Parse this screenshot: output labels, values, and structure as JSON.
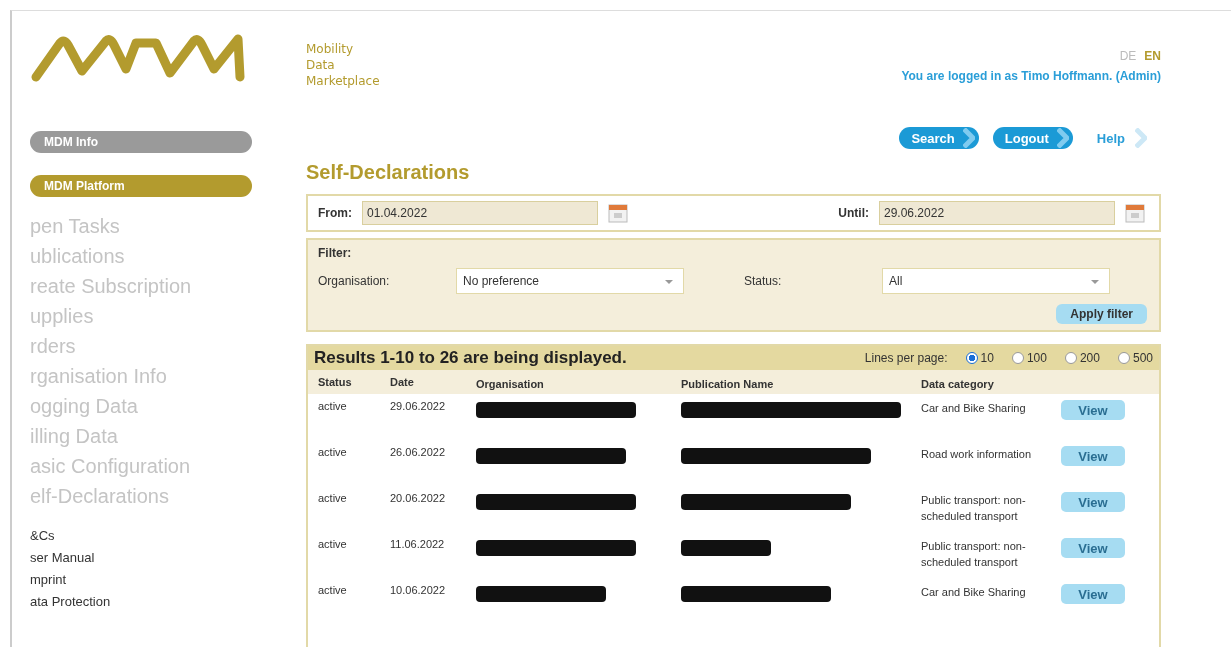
{
  "header": {
    "tagline": [
      "Mobility",
      "Data",
      "Marketplace"
    ],
    "languages": [
      {
        "label": "DE",
        "selected": false
      },
      {
        "label": "EN",
        "selected": true
      }
    ],
    "login_text": "You are logged in as Timo Hoffmann. (Admin)",
    "buttons": [
      {
        "label": "Search",
        "kind": "pill"
      },
      {
        "label": "Logout",
        "kind": "pill"
      },
      {
        "label": "Help",
        "kind": "link"
      }
    ]
  },
  "sidebar": {
    "sections": [
      {
        "label": "MDM Info",
        "selected": false
      },
      {
        "label": "MDM Platform",
        "selected": true
      }
    ],
    "items": [
      "pen Tasks",
      "ublications",
      "reate Subscription",
      "upplies",
      "rders",
      "rganisation Info",
      "ogging Data",
      "illing Data",
      "asic Configuration",
      "elf-Declarations"
    ],
    "footer_links": [
      "&Cs",
      "ser Manual",
      "mprint",
      "ata Protection"
    ]
  },
  "page_title": "Self-Declarations",
  "date_range": {
    "from_label": "From:",
    "from_value": "01.04.2022",
    "until_label": "Until:",
    "until_value": "29.06.2022"
  },
  "filter": {
    "title": "Filter:",
    "organisation_label": "Organisation:",
    "organisation_value": "No preference",
    "status_label": "Status:",
    "status_value": "All",
    "apply_button": "Apply filter"
  },
  "results": {
    "summary": "Results 1-10 to 26 are being displayed.",
    "lines_label": "Lines per page:",
    "lines_options": [
      {
        "label": "10",
        "selected": true
      },
      {
        "label": "100",
        "selected": false
      },
      {
        "label": "200",
        "selected": false
      },
      {
        "label": "500",
        "selected": false
      }
    ],
    "columns": [
      "Status",
      "Date",
      "Organisation",
      "Publication Name",
      "Data category"
    ],
    "rows": [
      {
        "status": "active",
        "date": "29.06.2022",
        "redacted": true,
        "category": "Car and Bike Sharing",
        "action": "View"
      },
      {
        "status": "active",
        "date": "26.06.2022",
        "redacted": true,
        "category": "Road work information",
        "action": "View"
      },
      {
        "status": "active",
        "date": "20.06.2022",
        "redacted": true,
        "category": "Public transport: non-scheduled transport",
        "action": "View"
      },
      {
        "status": "active",
        "date": "11.06.2022",
        "redacted": true,
        "category": "Public transport: non-scheduled transport",
        "action": "View"
      },
      {
        "status": "active",
        "date": "10.06.2022",
        "redacted": true,
        "category": "Car and Bike Sharing",
        "action": "View"
      }
    ]
  }
}
